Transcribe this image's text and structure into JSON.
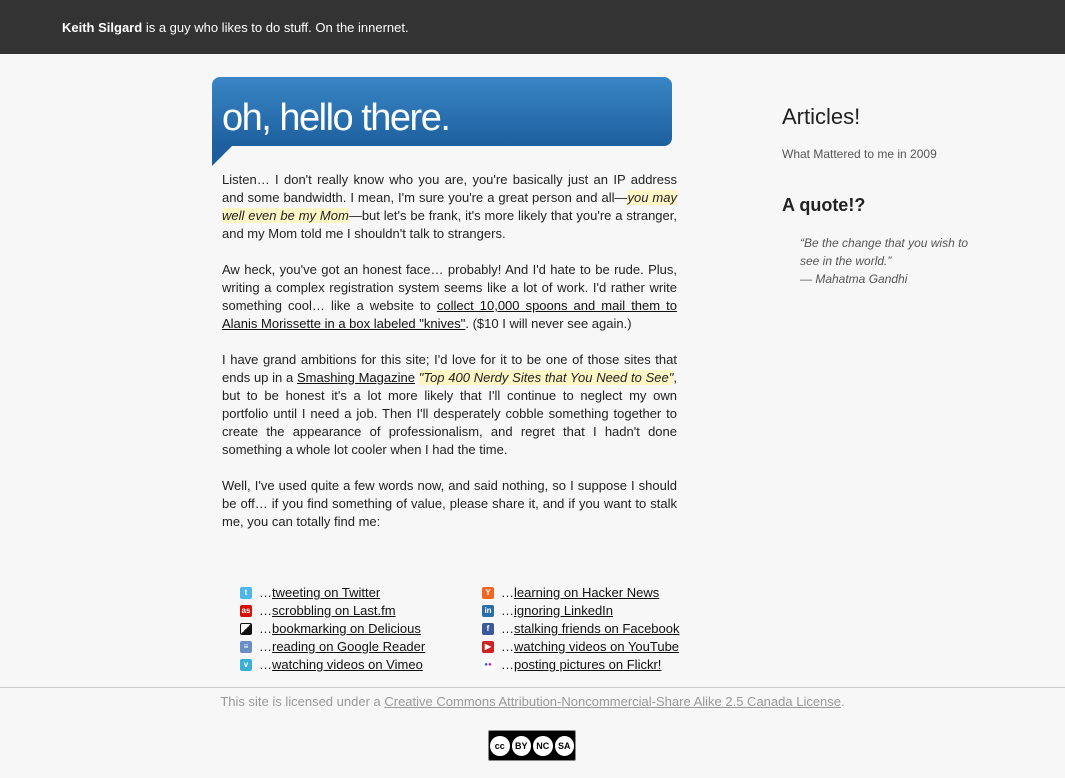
{
  "header": {
    "name": "Keith Silgard",
    "tagline": "is a guy who likes to do stuff. On the innernet."
  },
  "banner": {
    "title": "oh, hello there."
  },
  "intro": {
    "p1_a": "Listen… I don't really know who you are, you're basically just an IP address and some bandwidth. I mean, I'm sure you're a great person and all—",
    "p1_hl": "you may well even be my Mom",
    "p1_b": "—but let's be frank, it's more likely that you're a stranger, and my Mom told me I shouldn't talk to strangers.",
    "p2_a": "Aw heck, you've got an honest face… probably! And I'd hate to be rude. Plus, writing a complex registration system seems like a lot of work. I'd rather write something cool… like a website to ",
    "p2_link": "collect 10,000 spoons and mail them to Alanis Morissette in a box labeled \"knives\"",
    "p2_b": ". ($10 I will never see again.)",
    "p3_a": "I have grand ambitions for this site; I'd love for it to be one of those sites that ends up in a ",
    "p3_link": "Smashing Magazine",
    "p3_hl": "\"Top 400 Nerdy Sites that You Need to See\"",
    "p3_b": ", but to be honest it's a lot more likely that I'll continue to neglect my own portfolio until I need a job. Then I'll desperately cobble something together to create the appearance of professionalism, and regret that I hadn't done something a whole lot cooler when I had the time.",
    "p4": "Well, I've used quite a few words now, and said nothing, so I suppose I should be off… if you find something of value, please share it, and if you want to stalk me, you can totally find me:"
  },
  "links_col1": [
    {
      "prefix": "…",
      "text": "tweeting on Twitter",
      "icon": "twitter-icon",
      "color": "#4cb7e8",
      "glyph": "t"
    },
    {
      "prefix": "…",
      "text": "scrobbling on Last.fm",
      "icon": "lastfm-icon",
      "color": "#d51007",
      "glyph": "as"
    },
    {
      "prefix": "…",
      "text": "bookmarking on Delicious",
      "icon": "delicious-icon",
      "color": "#111111",
      "glyph": ""
    },
    {
      "prefix": "…",
      "text": "reading on Google Reader",
      "icon": "google-reader-icon",
      "color": "#6a8fc7",
      "glyph": "≡"
    },
    {
      "prefix": "…",
      "text": "watching videos on Vimeo",
      "icon": "vimeo-icon",
      "color": "#3ab0d8",
      "glyph": "v"
    }
  ],
  "links_col2": [
    {
      "prefix": "…",
      "text": "learning on Hacker News",
      "icon": "hacker-news-icon",
      "color": "#f26522",
      "glyph": "Y"
    },
    {
      "prefix": "…",
      "text": "ignoring LinkedIn",
      "icon": "linkedin-icon",
      "color": "#2a6ea8",
      "glyph": "in"
    },
    {
      "prefix": "…",
      "text": "stalking friends on Facebook",
      "icon": "facebook-icon",
      "color": "#3b5998",
      "glyph": "f"
    },
    {
      "prefix": "…",
      "text": "watching videos on YouTube",
      "icon": "youtube-icon",
      "color": "#cc2222",
      "glyph": "▶"
    },
    {
      "prefix": "…",
      "text": "posting pictures on Flickr!",
      "icon": "flickr-icon",
      "color": "#ffffff",
      "glyph": "●●"
    }
  ],
  "sidebar": {
    "articles_title": "Articles!",
    "article_1": "What Mattered to me in 2009",
    "quote_title": "A quote!?",
    "quote_text": "“Be the change that you wish to see in the world.”",
    "quote_author": "— Mahatma Gandhi"
  },
  "footer": {
    "license_prefix": "This site is licensed under a ",
    "license_link": "Creative Commons Attribution-Noncommercial-Share Alike 2.5 Canada License",
    "license_suffix": ".",
    "badge": [
      "cc",
      "BY",
      "NC",
      "SA"
    ]
  }
}
